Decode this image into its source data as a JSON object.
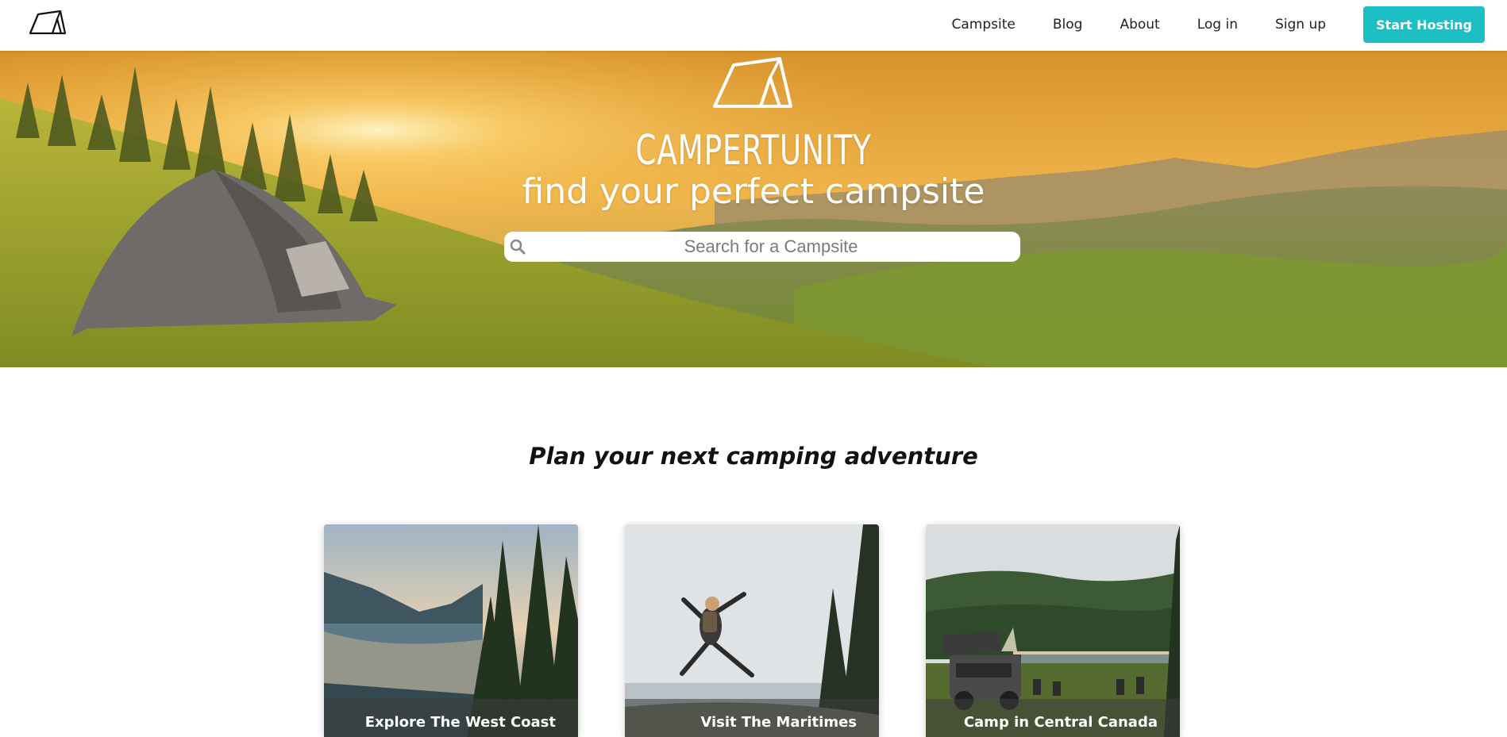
{
  "nav": {
    "logo_icon": "tent-logo-icon",
    "links": [
      "Campsite",
      "Blog",
      "About",
      "Log in",
      "Sign up"
    ],
    "cta_label": "Start Hosting",
    "cta_color": "#1bbfc4"
  },
  "hero": {
    "logo_icon": "tent-logo-icon",
    "brand": "CAMPERTUNITY",
    "tagline": "find your perfect campsite",
    "search_placeholder": "Search for a Campsite",
    "search_icon": "search-icon"
  },
  "section": {
    "title": "Plan your next camping adventure"
  },
  "cards": [
    {
      "caption": "Explore The West Coast"
    },
    {
      "caption": "Visit The Maritimes"
    },
    {
      "caption": "Camp in Central Canada"
    }
  ],
  "colors": {
    "accent": "#1bbfc4",
    "hero_sky": "#e9a93a",
    "hero_meadow": "#9aa534"
  }
}
